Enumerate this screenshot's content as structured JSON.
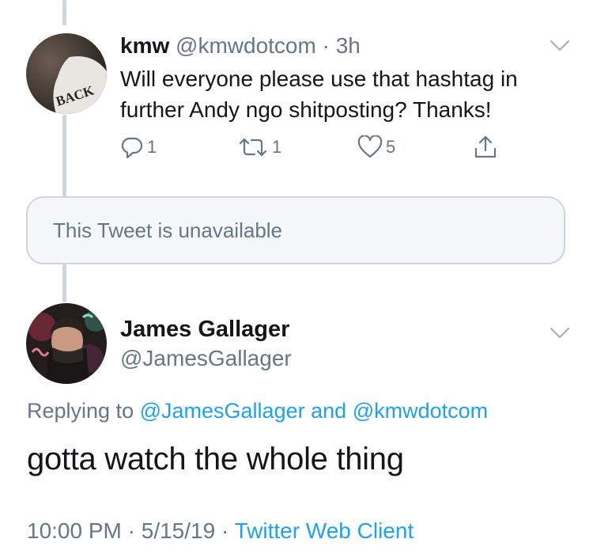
{
  "tweet1": {
    "display_name": "kmw",
    "handle": "@kmwdotcom",
    "separator": "·",
    "time": "3h",
    "text": "Will everyone please use that hashtag in further Andy ngo shitposting? Thanks!",
    "avatar_text": "BACK",
    "actions": {
      "replies": "1",
      "retweets": "1",
      "likes": "5"
    }
  },
  "unavailable_card": {
    "text": "This Tweet is unavailable"
  },
  "tweet2": {
    "display_name": "James Gallager",
    "handle": "@JamesGallager",
    "replying_prefix": "Replying to",
    "replying_handle_1": "@JamesGallager",
    "replying_conjunction": "and",
    "replying_handle_2": "@kmwdotcom",
    "text": "gotta watch the whole thing",
    "time": "10:00 PM",
    "date": "5/15/19",
    "separator": "·",
    "client": "Twitter Web Client"
  },
  "colors": {
    "link": "#1da1f2",
    "secondary_text": "#657786",
    "thread_line": "#ccd6dd",
    "card_bg": "#f5f8fa"
  },
  "icons": [
    "reply-icon",
    "retweet-icon",
    "like-icon",
    "share-icon",
    "chevron-down-icon"
  ]
}
